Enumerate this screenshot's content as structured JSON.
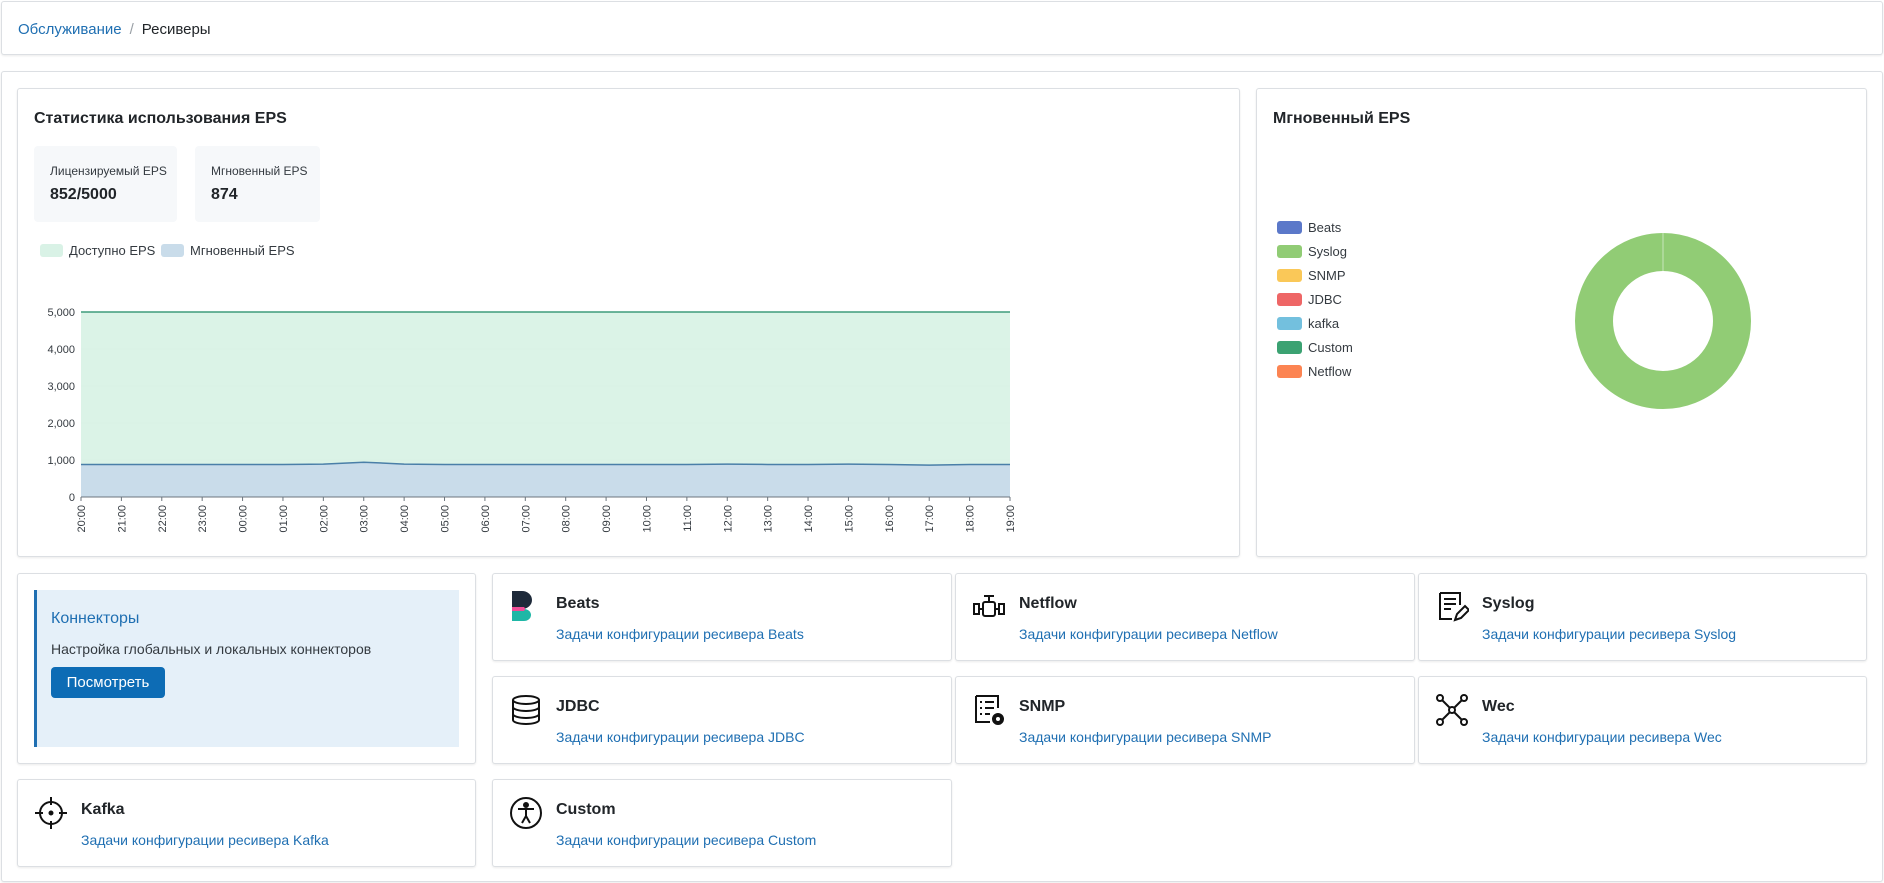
{
  "breadcrumb": {
    "parent": "Обслуживание",
    "separator": "/",
    "current": "Ресиверы"
  },
  "eps_card": {
    "title": "Статистика использования EPS",
    "stats": [
      {
        "label": "Лицензируемый EPS",
        "value": "852/5000"
      },
      {
        "label": "Мгновенный EPS",
        "value": "874"
      }
    ],
    "legend": [
      {
        "label": "Доступно EPS",
        "color": "#d9f2e6"
      },
      {
        "label": "Мгновенный EPS",
        "color": "#c9dcea"
      }
    ]
  },
  "chart_data": [
    {
      "type": "area",
      "ylim": [
        0,
        5000
      ],
      "yticks": [
        "5,000",
        "4,000",
        "3,000",
        "2,000",
        "1,000",
        "0"
      ],
      "ytick_values": [
        5000,
        4000,
        3000,
        2000,
        1000,
        0
      ],
      "x": [
        "20:00",
        "21:00",
        "22:00",
        "23:00",
        "00:00",
        "01:00",
        "02:00",
        "03:00",
        "04:00",
        "05:00",
        "06:00",
        "07:00",
        "08:00",
        "09:00",
        "10:00",
        "11:00",
        "12:00",
        "13:00",
        "14:00",
        "15:00",
        "16:00",
        "17:00",
        "18:00",
        "19:00"
      ],
      "series": [
        {
          "name": "Доступно EPS",
          "color": "#d9f2e6",
          "line": "#3e9b7b",
          "values": [
            5000,
            5000,
            5000,
            5000,
            5000,
            5000,
            5000,
            5000,
            5000,
            5000,
            5000,
            5000,
            5000,
            5000,
            5000,
            5000,
            5000,
            5000,
            5000,
            5000,
            5000,
            5000,
            5000,
            5000
          ]
        },
        {
          "name": "Мгновенный EPS",
          "color": "#c9dcea",
          "line": "#4a7fa8",
          "values": [
            880,
            880,
            880,
            880,
            880,
            880,
            890,
            940,
            890,
            880,
            880,
            880,
            880,
            880,
            880,
            880,
            890,
            880,
            880,
            890,
            880,
            860,
            880,
            880
          ]
        }
      ],
      "grid": true
    },
    {
      "type": "pie",
      "title": "Мгновенный EPS",
      "categories": [
        "Beats",
        "Syslog",
        "SNMP",
        "JDBC",
        "kafka",
        "Custom",
        "Netflow"
      ],
      "colors": [
        "#5b78c9",
        "#91cc75",
        "#fac858",
        "#ee6666",
        "#73c0de",
        "#3ba272",
        "#fc8452"
      ],
      "values": [
        0,
        874,
        0,
        0,
        0,
        0,
        0
      ],
      "donut": true
    }
  ],
  "instant_card": {
    "title": "Мгновенный EPS"
  },
  "connectors": {
    "title": "Коннекторы",
    "description": "Настройка глобальных и локальных коннекторов",
    "button": "Посмотреть"
  },
  "receivers": [
    {
      "title": "Beats",
      "link": "Задачи конфигурации ресивера Beats",
      "icon": "beats-logo-icon"
    },
    {
      "title": "Netflow",
      "link": "Задачи конфигурации ресивера Netflow",
      "icon": "pipeline-valve-icon"
    },
    {
      "title": "Syslog",
      "link": "Задачи конфигурации ресивера Syslog",
      "icon": "document-edit-icon"
    },
    {
      "title": "JDBC",
      "link": "Задачи конфигурации ресивера JDBC",
      "icon": "database-icon"
    },
    {
      "title": "SNMP",
      "link": "Задачи конфигурации ресивера SNMP",
      "icon": "list-gear-icon"
    },
    {
      "title": "Wec",
      "link": "Задачи конфигурации ресивера Wec",
      "icon": "network-nodes-icon"
    },
    {
      "title": "Kafka",
      "link": "Задачи конфигурации ресивера Kafka",
      "icon": "crosshair-icon"
    },
    {
      "title": "Custom",
      "link": "Задачи конфигурации ресивера Custom",
      "icon": "accessibility-icon"
    }
  ]
}
